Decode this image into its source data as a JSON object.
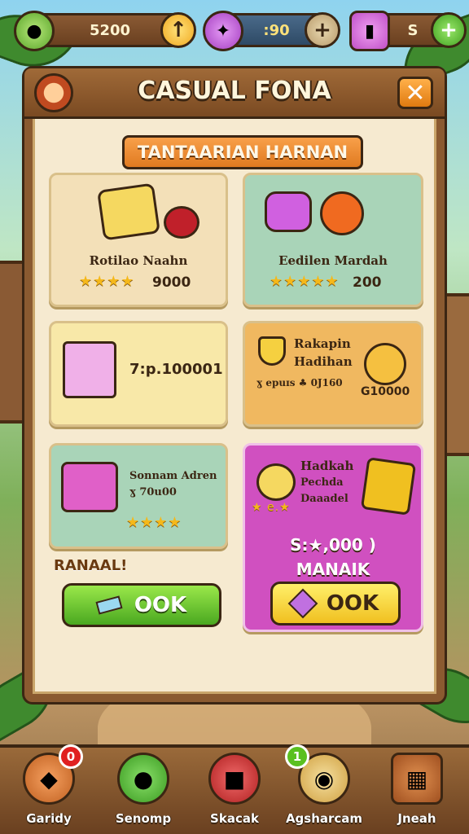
{
  "currencies": [
    {
      "name": "coins",
      "value": "5200",
      "add_label": "↑"
    },
    {
      "name": "gems",
      "value": ":90",
      "add_label": "+"
    },
    {
      "name": "potions",
      "value": "S",
      "add_label": "+"
    }
  ],
  "panel": {
    "title": "CASUAL FONA",
    "subtitle": "TANTAARIAN HARNAN",
    "close_label": "✕"
  },
  "cards": [
    {
      "name": "Rotilao Naahn",
      "stars": "★★★★",
      "price": "9000"
    },
    {
      "name": "Eedilen Mardah",
      "stars": "★★★★★",
      "price": "200"
    },
    {
      "name": "",
      "stars": "",
      "price": "7:p.100001"
    },
    {
      "name_line1": "Rakapin",
      "name_line2": "Hadihan",
      "detail": "ɣ epuɪs ♣ 0J160",
      "price": "G10000"
    },
    {
      "name_line1": "Sonnam Adren",
      "name_line2": "ɣ 70u00",
      "stars": "★★★★"
    },
    {
      "name_line1": "Hadkah",
      "name_line2": "Pechda",
      "name_line3": "Daaadel",
      "stars_small": "★ e.★",
      "price": "S:★,000 )",
      "price_label": "MANAIK"
    }
  ],
  "buttons": {
    "banner": "RANAAL!",
    "ok_green": "OOK",
    "ok_yellow": "OOK"
  },
  "nav": [
    {
      "label": "Garidy",
      "badge": "0"
    },
    {
      "label": "Senomp",
      "badge": ""
    },
    {
      "label": "Skacak",
      "badge": ""
    },
    {
      "label": "Agsharcam",
      "badge": "1"
    },
    {
      "label": "Jneah",
      "badge": ""
    }
  ],
  "colors": {
    "panel_wood": "#8a5a30",
    "accent_orange": "#e07a20",
    "green_button": "#4aa820",
    "yellow_button": "#f0c020",
    "magenta_card": "#d050c0"
  }
}
